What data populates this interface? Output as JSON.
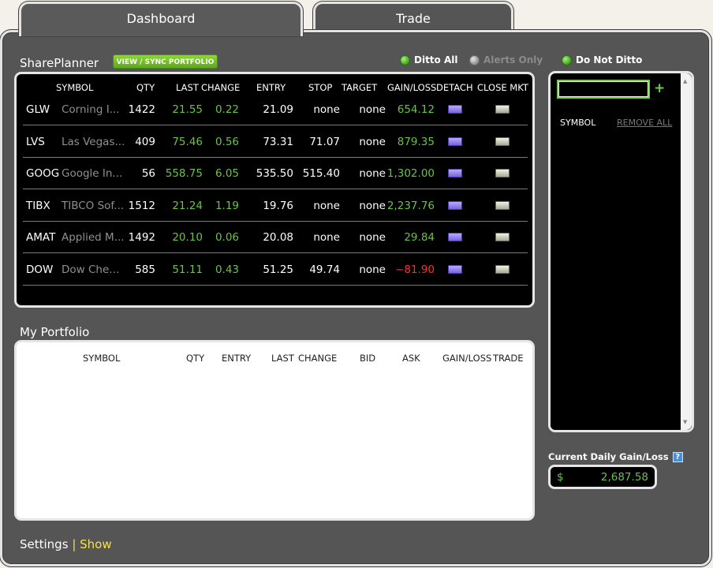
{
  "tabs": {
    "dashboard": "Dashboard",
    "trade": "Trade"
  },
  "shareplanner": {
    "title": "SharePlanner",
    "sync_button": "VIEW / SYNC PORTFOLIO",
    "radios": {
      "ditto_all": "Ditto All",
      "alerts_only": "Alerts Only",
      "do_not_ditto": "Do Not Ditto"
    },
    "columns": [
      "SYMBOL",
      "QTY",
      "LAST",
      "CHANGE",
      "ENTRY",
      "STOP",
      "TARGET",
      "GAIN/LOSS",
      "DETACH",
      "CLOSE MKT"
    ],
    "rows": [
      {
        "symbol": "GLW",
        "name": "Corning I...",
        "qty": "1422",
        "last": "21.55",
        "change": "0.22",
        "entry": "21.09",
        "stop": "none",
        "target": "none",
        "gain": "654.12"
      },
      {
        "symbol": "LVS",
        "name": "Las Vegas...",
        "qty": "409",
        "last": "75.46",
        "change": "0.56",
        "entry": "73.31",
        "stop": "71.07",
        "target": "none",
        "gain": "879.35"
      },
      {
        "symbol": "GOOG",
        "name": "Google In...",
        "qty": "56",
        "last": "558.75",
        "change": "6.05",
        "entry": "535.50",
        "stop": "515.40",
        "target": "none",
        "gain": "1,302.00"
      },
      {
        "symbol": "TIBX",
        "name": "TIBCO Sof...",
        "qty": "1512",
        "last": "21.24",
        "change": "1.19",
        "entry": "19.76",
        "stop": "none",
        "target": "none",
        "gain": "2,237.76"
      },
      {
        "symbol": "AMAT",
        "name": "Applied M...",
        "qty": "1492",
        "last": "20.10",
        "change": "0.06",
        "entry": "20.08",
        "stop": "none",
        "target": "none",
        "gain": "29.84"
      },
      {
        "symbol": "DOW",
        "name": "Dow Che...",
        "qty": "585",
        "last": "51.11",
        "change": "0.43",
        "entry": "51.25",
        "stop": "49.74",
        "target": "none",
        "gain": "-81.90"
      }
    ]
  },
  "portfolio": {
    "title": "My Portfolio",
    "columns": [
      "SYMBOL",
      "QTY",
      "ENTRY",
      "LAST",
      "CHANGE",
      "BID",
      "ASK",
      "GAIN/LOSS",
      "TRADE"
    ]
  },
  "watchlist": {
    "input_value": "",
    "add_label": "+",
    "symbol_header": "SYMBOL",
    "remove_all": "REMOVE ALL"
  },
  "daily_gain": {
    "label": "Current Daily Gain/Loss",
    "currency": "$",
    "value": "2,687.58",
    "help": "?"
  },
  "footer": {
    "settings": "Settings",
    "separator": "|",
    "show": "Show"
  },
  "colors": {
    "positive": "#6ac24a",
    "negative": "#ff2b2b",
    "accent": "#8ed63a"
  }
}
